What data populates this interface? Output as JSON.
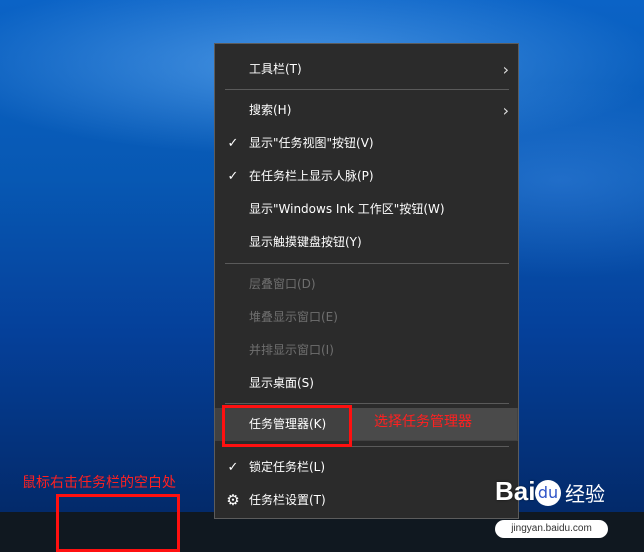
{
  "context_menu": {
    "items": [
      {
        "label": "工具栏(T)",
        "check": "",
        "arrow": "›"
      },
      {
        "label": "搜索(H)",
        "check": "",
        "arrow": "›"
      },
      {
        "label": "显示\"任务视图\"按钮(V)",
        "check": "✓",
        "arrow": ""
      },
      {
        "label": "在任务栏上显示人脉(P)",
        "check": "✓",
        "arrow": ""
      },
      {
        "label": "显示\"Windows Ink 工作区\"按钮(W)",
        "check": "",
        "arrow": ""
      },
      {
        "label": "显示触摸键盘按钮(Y)",
        "check": "",
        "arrow": ""
      },
      {
        "label": "层叠窗口(D)",
        "check": "",
        "arrow": "",
        "disabled": true
      },
      {
        "label": "堆叠显示窗口(E)",
        "check": "",
        "arrow": "",
        "disabled": true
      },
      {
        "label": "并排显示窗口(I)",
        "check": "",
        "arrow": "",
        "disabled": true
      },
      {
        "label": "显示桌面(S)",
        "check": "",
        "arrow": ""
      },
      {
        "label": "任务管理器(K)",
        "check": "",
        "arrow": "",
        "highlighted": true
      },
      {
        "label": "锁定任务栏(L)",
        "check": "✓",
        "arrow": ""
      },
      {
        "label": "任务栏设置(T)",
        "icon": "gear-icon",
        "glyph": "⚙"
      }
    ]
  },
  "annotations": {
    "select_task_manager": "选择任务管理器",
    "right_click_taskbar": "鼠标右击任务栏的空白处",
    "highlight_color": "#ff1010"
  },
  "watermark": {
    "brand": "Bai",
    "paw": "du",
    "cn": "经验",
    "site": "jingyan.baidu.com"
  }
}
